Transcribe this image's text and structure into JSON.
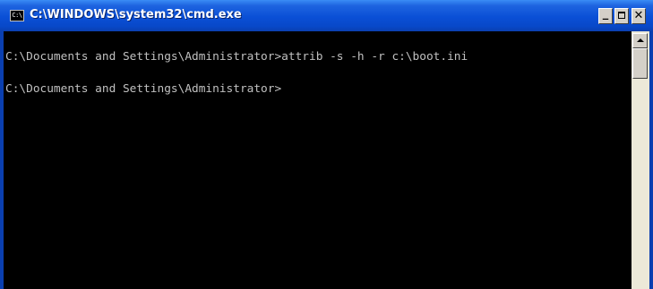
{
  "window": {
    "title": "C:\\WINDOWS\\system32\\cmd.exe",
    "icon_label": "C:\\",
    "minimize_label": "_",
    "close_label": "✕"
  },
  "console": {
    "lines": [
      "C:\\Documents and Settings\\Administrator>attrib -s -h -r c:\\boot.ini",
      "C:\\Documents and Settings\\Administrator>"
    ]
  },
  "icons": {
    "app": "console-app-icon",
    "minimize": "minimize-icon",
    "maximize": "maximize-icon",
    "close": "close-icon",
    "scroll_up": "arrow-up-icon"
  },
  "colors": {
    "titlebar": "#0a4fd6",
    "console_bg": "#000000",
    "console_text": "#c0c0c0"
  }
}
